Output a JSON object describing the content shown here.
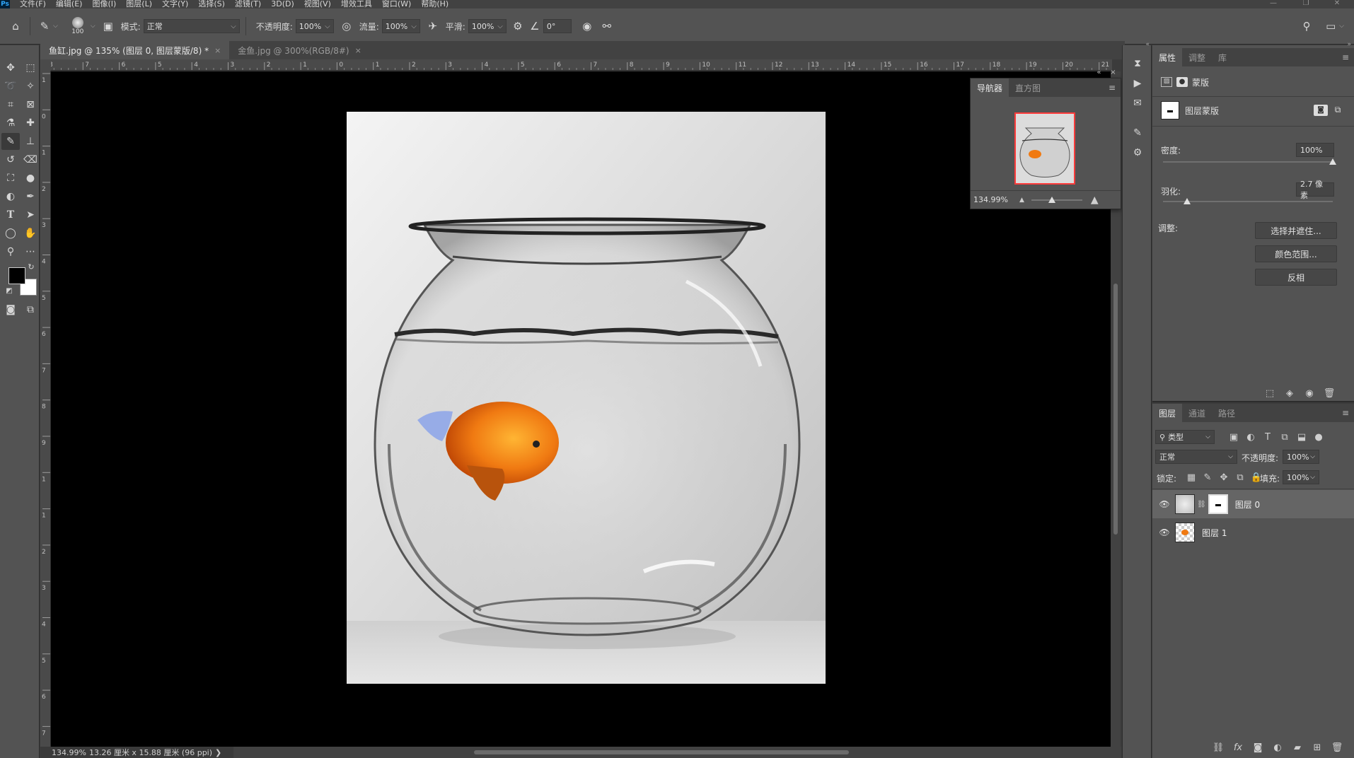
{
  "app": {
    "logo": "Ps"
  },
  "menu": [
    "文件(F)",
    "编辑(E)",
    "图像(I)",
    "图层(L)",
    "文字(Y)",
    "选择(S)",
    "滤镜(T)",
    "3D(D)",
    "视图(V)",
    "增效工具",
    "窗口(W)",
    "帮助(H)"
  ],
  "window_controls": {
    "minimize": "—",
    "restore": "❐",
    "close": "✕"
  },
  "options": {
    "brush_size": "100",
    "mode_label": "模式:",
    "mode_value": "正常",
    "opacity_label": "不透明度:",
    "opacity_value": "100%",
    "flow_label": "流量:",
    "flow_value": "100%",
    "smooth_label": "平滑:",
    "smooth_value": "100%",
    "angle_value": "0°"
  },
  "tabs": [
    {
      "label": "鱼缸.jpg @ 135% (图层 0, 图层蒙版/8) *",
      "close": "×"
    },
    {
      "label": "金鱼.jpg @ 300%(RGB/8#)",
      "close": "×"
    }
  ],
  "ruler_top": [
    "8",
    "7",
    "6",
    "5",
    "4",
    "3",
    "2",
    "1",
    "0",
    "1",
    "2",
    "3",
    "4",
    "5",
    "6",
    "7",
    "8",
    "9",
    "10",
    "11",
    "12",
    "13",
    "14",
    "15",
    "16",
    "17",
    "18",
    "19",
    "20",
    "21"
  ],
  "ruler_left": [
    "1",
    "0",
    "1",
    "2",
    "3",
    "4",
    "5",
    "6",
    "7",
    "8",
    "9",
    "1",
    "1",
    "2",
    "3",
    "4",
    "5",
    "6",
    "7"
  ],
  "status": {
    "zoom": "134.99%",
    "doc_info": "13.26 厘米 x 15.88 厘米 (96 ppi)",
    "arrow": "❯"
  },
  "navigator": {
    "tab_navigator": "导航器",
    "tab_histogram": "直方图",
    "zoom": "134.99%",
    "zoom_fraction": 0.4
  },
  "properties": {
    "tab_properties": "属性",
    "tab_adjust": "调整",
    "tab_library": "库",
    "mask_title": "蒙版",
    "layer_mask_label": "图层蒙版",
    "density_label": "密度:",
    "density_value": "100%",
    "density_fraction": 1.0,
    "feather_label": "羽化:",
    "feather_value": "2.7 像素",
    "feather_fraction": 0.14,
    "adjust_label": "调整:",
    "btn_select_mask": "选择并遮住...",
    "btn_color_range": "颜色范围...",
    "btn_invert": "反相"
  },
  "layers": {
    "tab_layers": "图层",
    "tab_channels": "通道",
    "tab_paths": "路径",
    "filter_value": "类型",
    "blend_value": "正常",
    "opacity_label": "不透明度:",
    "opacity_value": "100%",
    "lock_label": "锁定:",
    "fill_label": "填充:",
    "fill_value": "100%",
    "items": [
      {
        "name": "图层 0"
      },
      {
        "name": "图层 1"
      }
    ]
  },
  "colors": {
    "accent_tab": "#535353",
    "nav_frame": "#ff3b3b",
    "fish": "#f07a12"
  }
}
